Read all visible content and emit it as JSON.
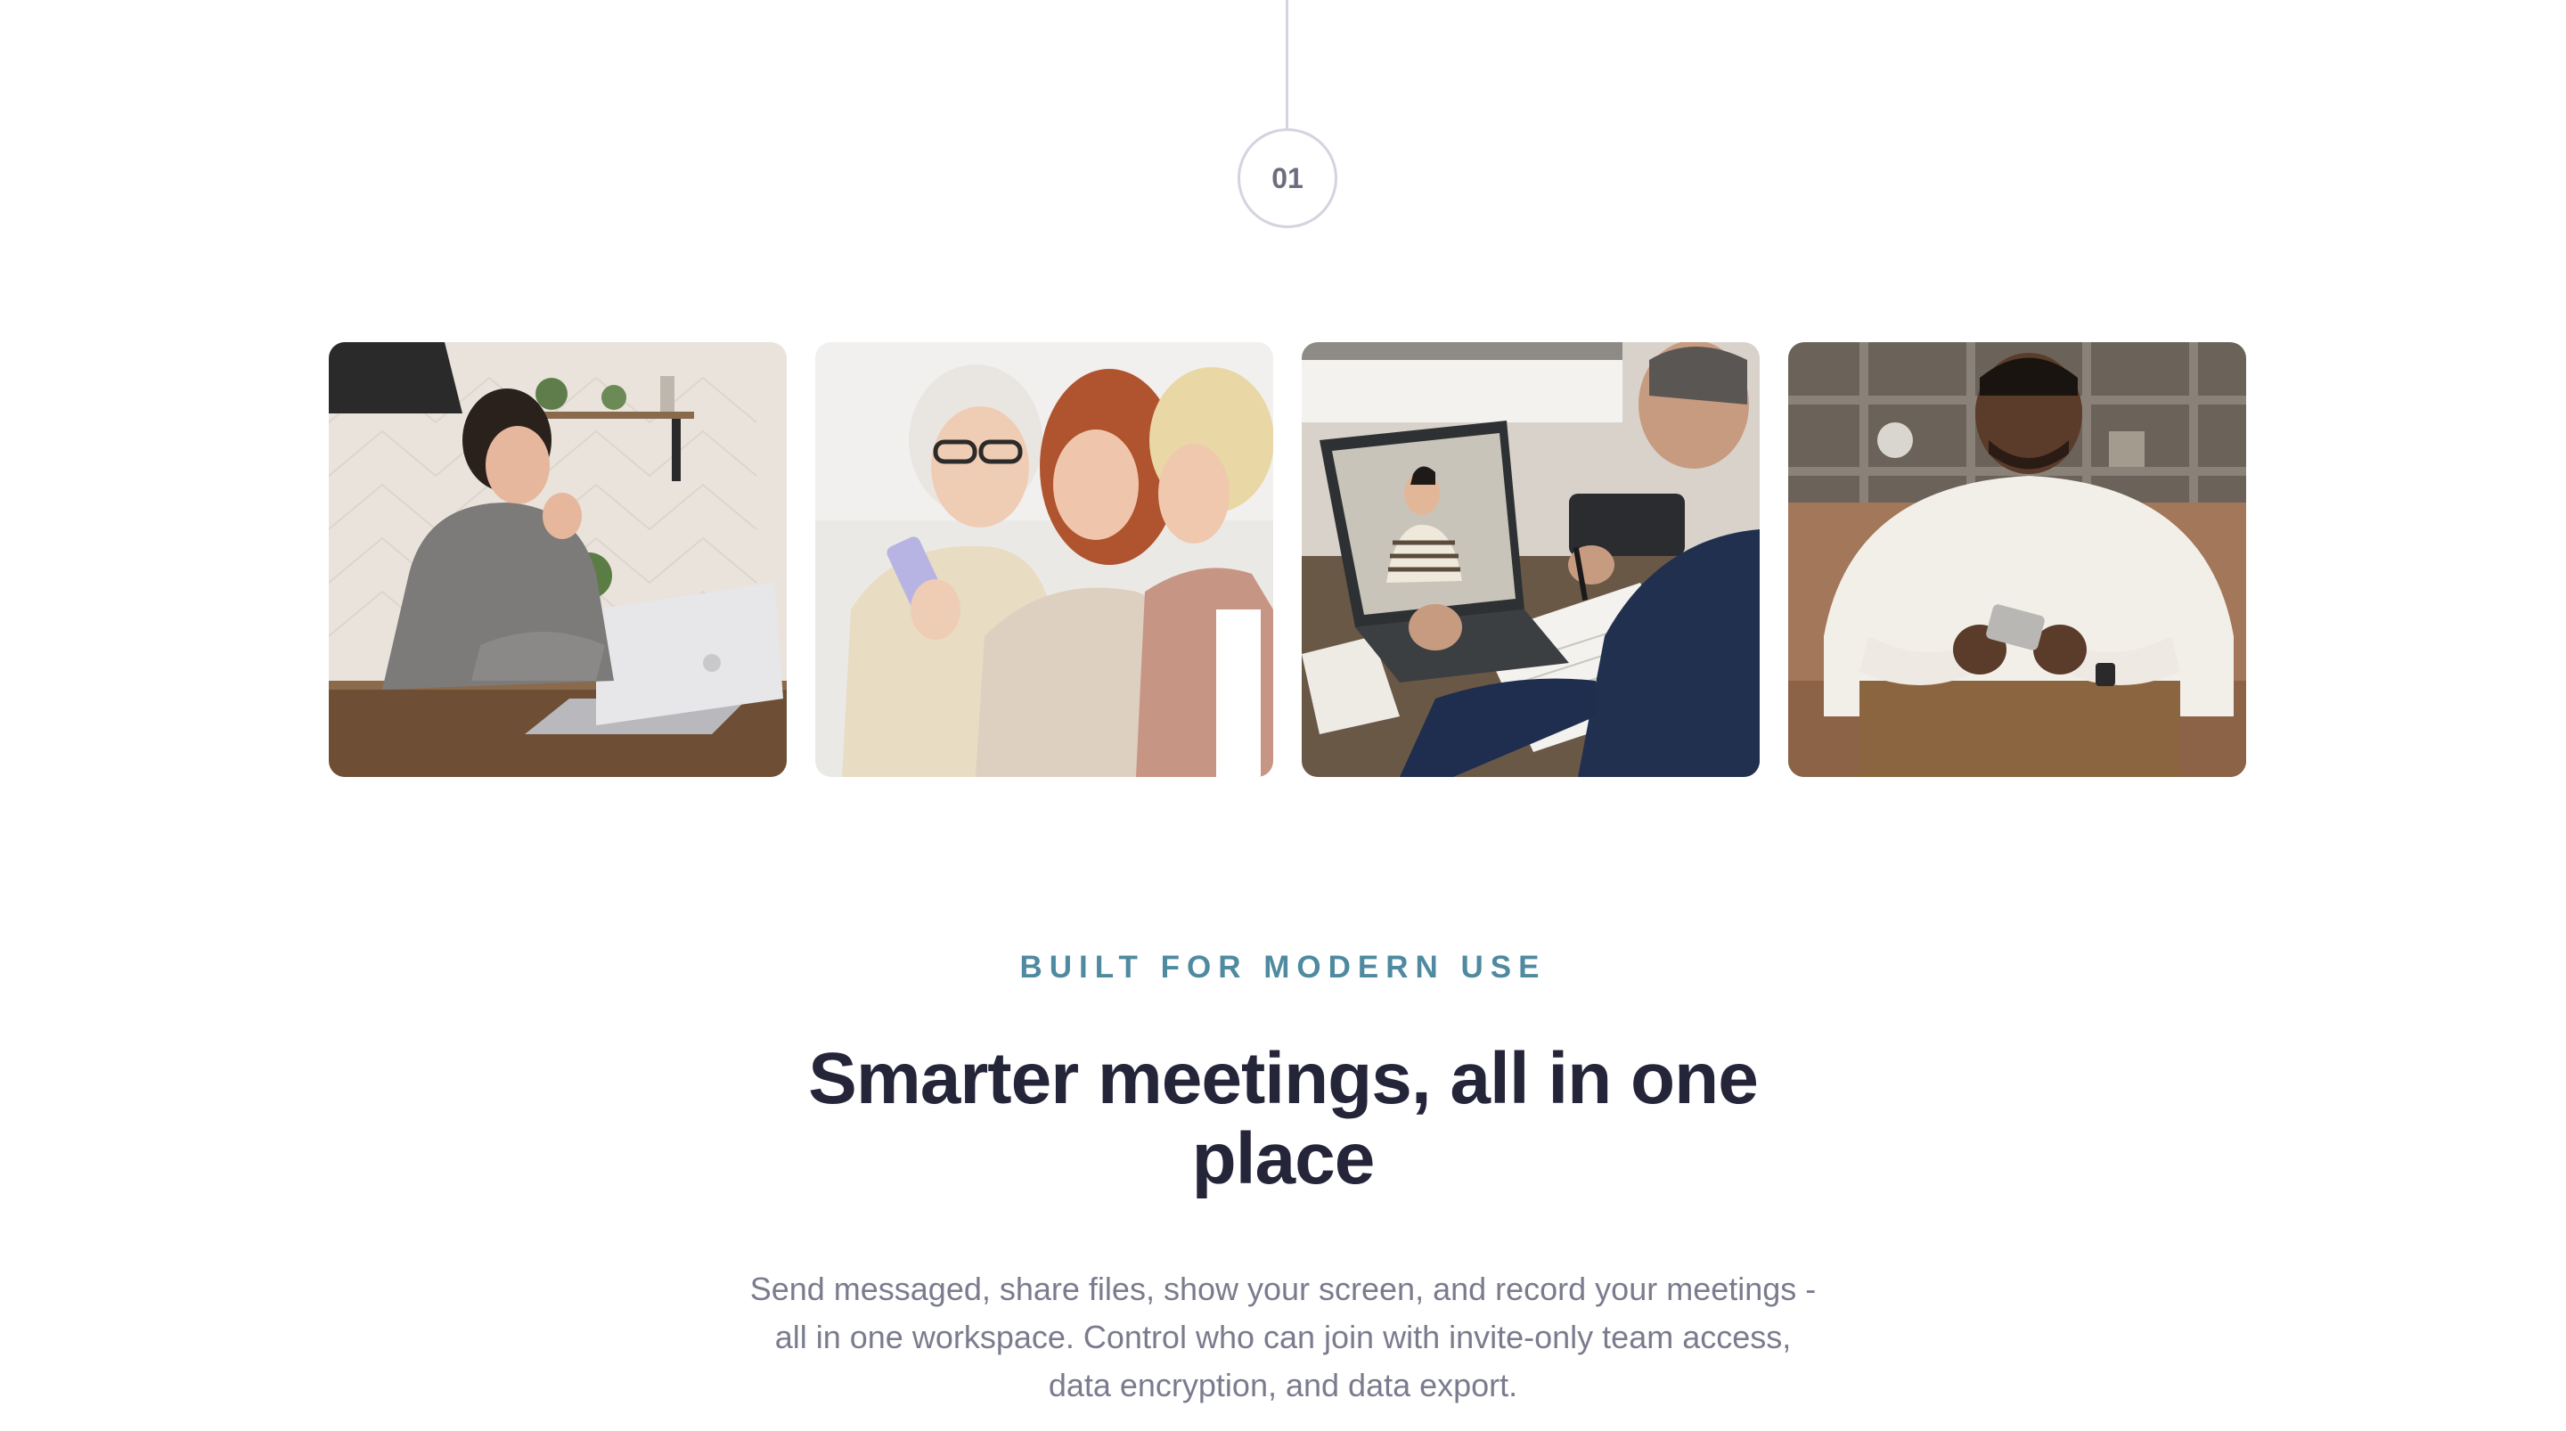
{
  "timeline": {
    "step_number": "01"
  },
  "photos": [
    {
      "alt": "Woman laughing at a laptop in a kitchen"
    },
    {
      "alt": "Three women looking at a smartphone together"
    },
    {
      "alt": "Man on a video call with a laptop"
    },
    {
      "alt": "Man smiling at his smartphone on a couch"
    }
  ],
  "section": {
    "eyebrow": "BUILT FOR MODERN USE",
    "headline": "Smarter meetings, all in one place",
    "body": "Send messaged, share files, show your screen, and record your meetings - all in one workspace. Control who can join with invite-only team access, data encryption, and data export."
  },
  "colors": {
    "accent": "#4f8aa0",
    "heading": "#25253a",
    "body": "#7a7c8e",
    "timeline": "#d2d4df"
  }
}
